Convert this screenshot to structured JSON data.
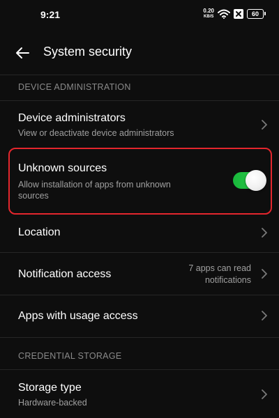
{
  "status_bar": {
    "time": "9:21",
    "net_speed_value": "0.20",
    "net_speed_unit": "KB/S",
    "battery": "60"
  },
  "header": {
    "title": "System security"
  },
  "sections": {
    "device_admin": {
      "header": "DEVICE ADMINISTRATION"
    },
    "credential": {
      "header": "CREDENTIAL STORAGE"
    }
  },
  "rows": {
    "device_admins": {
      "title": "Device administrators",
      "subtitle": "View or deactivate device administrators"
    },
    "unknown_sources": {
      "title": "Unknown sources",
      "subtitle_line1": "Allow installation of apps from unknown",
      "subtitle_line2": "sources",
      "enabled": true
    },
    "location": {
      "title": "Location"
    },
    "notification_access": {
      "title": "Notification access",
      "value_line1": "7 apps can read",
      "value_line2": "notifications"
    },
    "usage_access": {
      "title": "Apps with usage access"
    },
    "storage_type": {
      "title": "Storage type",
      "subtitle": "Hardware-backed"
    }
  },
  "colors": {
    "background": "#0e0e0e",
    "toggle_on": "#2fcf4c",
    "highlight": "#e4262d",
    "section_header": "#8a8a8a"
  }
}
